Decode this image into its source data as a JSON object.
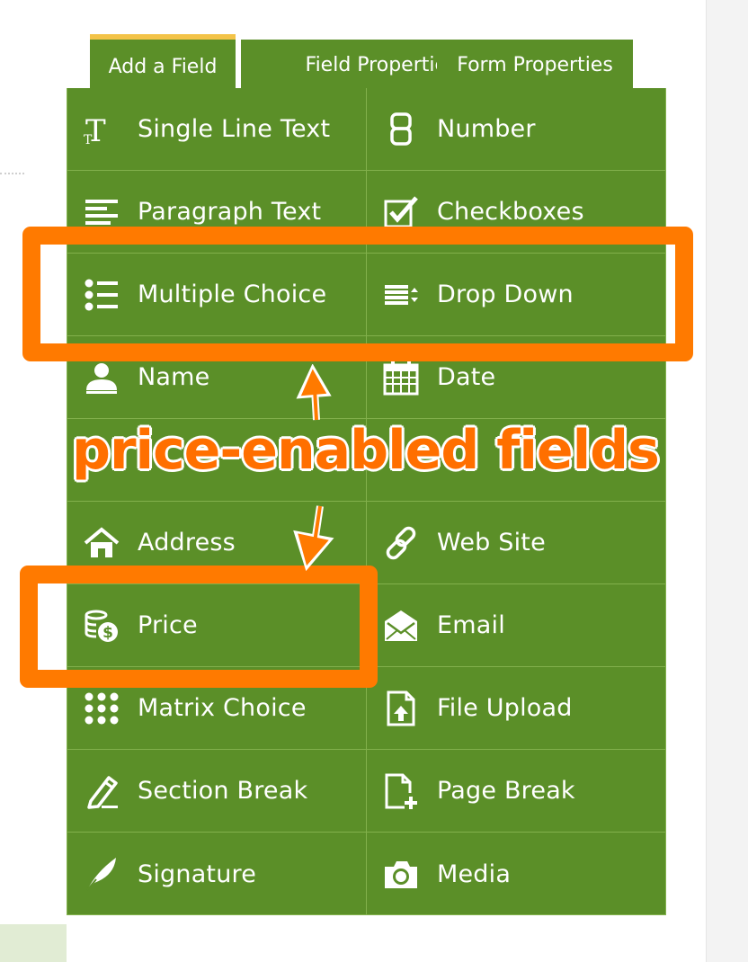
{
  "tabs": [
    {
      "label": "Add a Field",
      "active": true
    },
    {
      "label": "Field Properties",
      "active": false
    },
    {
      "label": "Form Properties",
      "active": false
    }
  ],
  "fields": [
    {
      "label": "Single Line Text",
      "icon": "single-line-text-icon"
    },
    {
      "label": "Number",
      "icon": "number-icon"
    },
    {
      "label": "Paragraph Text",
      "icon": "paragraph-text-icon"
    },
    {
      "label": "Checkboxes",
      "icon": "checkbox-icon"
    },
    {
      "label": "Multiple Choice",
      "icon": "multiple-choice-icon"
    },
    {
      "label": "Drop Down",
      "icon": "drop-down-icon"
    },
    {
      "label": "Name",
      "icon": "person-icon"
    },
    {
      "label": "Date",
      "icon": "calendar-icon"
    },
    {
      "label": "",
      "icon": ""
    },
    {
      "label": "",
      "icon": ""
    },
    {
      "label": "Address",
      "icon": "home-icon"
    },
    {
      "label": "Web Site",
      "icon": "link-icon"
    },
    {
      "label": "Price",
      "icon": "coins-icon"
    },
    {
      "label": "Email",
      "icon": "envelope-icon"
    },
    {
      "label": "Matrix Choice",
      "icon": "grid-dots-icon"
    },
    {
      "label": "File Upload",
      "icon": "file-upload-icon"
    },
    {
      "label": "Section Break",
      "icon": "pencil-icon"
    },
    {
      "label": "Page Break",
      "icon": "page-add-icon"
    },
    {
      "label": "Signature",
      "icon": "feather-icon"
    },
    {
      "label": "Media",
      "icon": "camera-icon"
    }
  ],
  "annotation": {
    "text": "price-enabled fields",
    "color": "#ff7a00"
  },
  "colors": {
    "panel": "#5b8f28",
    "tab_active_accent": "#f3c348"
  }
}
